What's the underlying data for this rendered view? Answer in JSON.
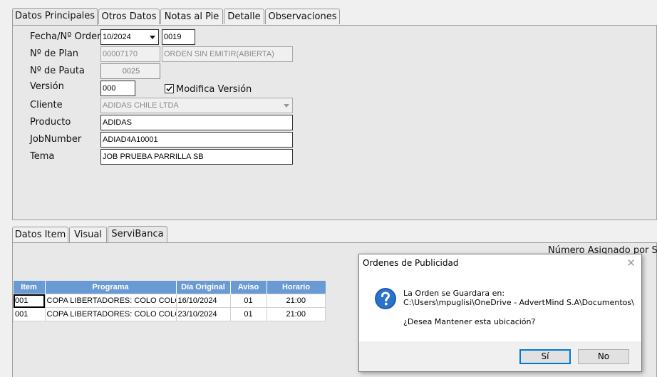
{
  "top_tabs": [
    "Datos Principales",
    "Otros Datos",
    "Notas al Pie",
    "Detalle",
    "Observaciones"
  ],
  "form": {
    "fecha_label": "Fecha/Nº Orden",
    "fecha_value": "10/2024",
    "orden_value": "0019",
    "plan_label": "Nº de Plan",
    "plan_value": "00007170",
    "plan_status": "ORDEN SIN EMITIR(ABIERTA)",
    "pauta_label": "Nº de Pauta",
    "pauta_value": "0025",
    "version_label": "Versión",
    "version_value": "000",
    "modifica_label": "Modifica Versión",
    "modifica_checked": true,
    "cliente_label": "Cliente",
    "cliente_value": "ADIDAS CHILE LTDA",
    "producto_label": "Producto",
    "producto_value": "ADIDAS",
    "jobnumber_label": "JobNumber",
    "jobnumber_value": "ADIAD4A10001",
    "tema_label": "Tema",
    "tema_value": "JOB PRUEBA PARRILLA SB"
  },
  "bottom_tabs": [
    "Datos Item",
    "Visual",
    "ServiBanca"
  ],
  "numero_asignado": "Número Asignado por Serv",
  "grid": {
    "headers": [
      "Item",
      "Programa",
      "Día Original",
      "Aviso",
      "Horario"
    ],
    "rows": [
      [
        "001",
        "COPA LIBERTADORES: COLO COLO V",
        "16/10/2024",
        "01",
        "21:00"
      ],
      [
        "001",
        "COPA LIBERTADORES: COLO COLO V",
        "23/10/2024",
        "01",
        "21:00"
      ]
    ]
  },
  "dialog": {
    "title": "Ordenes de Publicidad",
    "close": "✕",
    "line1": "La Orden se Guardara en:",
    "line2": "C:\\Users\\mpuglisi\\OneDrive - AdvertMind S.A\\Documentos\\",
    "line3": "¿Desea Mantener esta ubicación?",
    "yes": "Sí",
    "no": "No"
  },
  "colors": {
    "grid_header": "#6a9ad4",
    "icon_blue": "#1f5fb5",
    "accent": "#0078d7"
  }
}
